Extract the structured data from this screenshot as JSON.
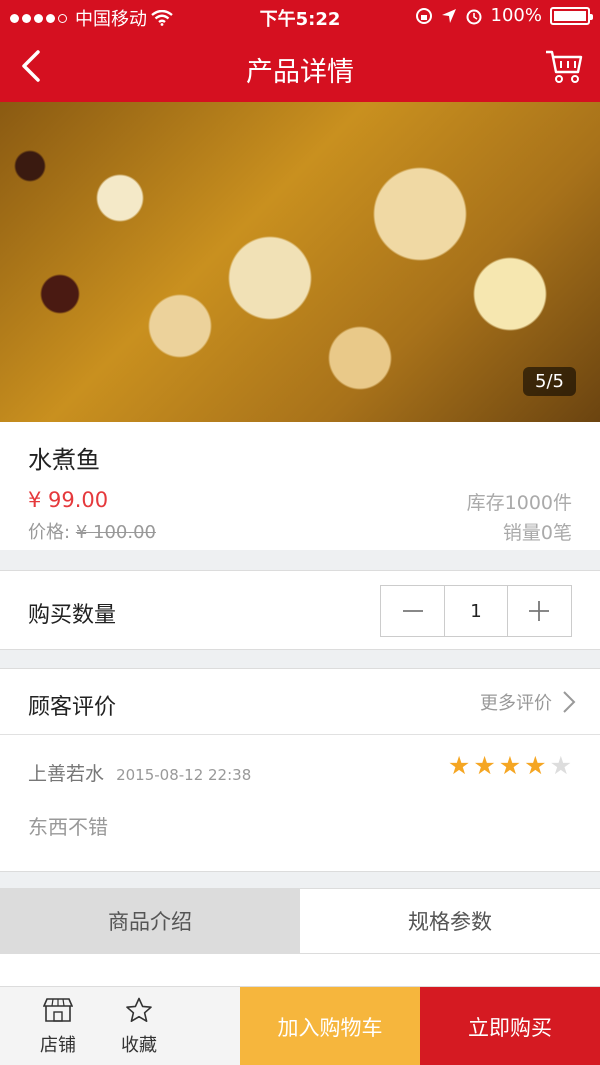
{
  "status_bar": {
    "carrier": "中国移动",
    "time": "下午5:22",
    "battery": "100%"
  },
  "nav": {
    "title": "产品详情"
  },
  "gallery": {
    "pager": "5/5"
  },
  "product": {
    "name": "水煮鱼",
    "price": "¥ 99.00",
    "original_price_label": "价格:",
    "original_price": "¥ 100.00",
    "stock": "库存1000件",
    "sales": "销量0笔"
  },
  "quantity": {
    "label": "购买数量",
    "value": "1"
  },
  "reviews": {
    "title": "顾客评价",
    "more_label": "更多评价",
    "items": [
      {
        "user": "上善若水",
        "date": "2015-08-12 22:38",
        "rating": 4,
        "max_rating": 5,
        "text": "东西不错"
      }
    ]
  },
  "tabs": [
    {
      "label": "商品介绍",
      "active": true
    },
    {
      "label": "规格参数",
      "active": false
    }
  ],
  "bottom_bar": {
    "shop_label": "店铺",
    "favorite_label": "收藏",
    "add_to_cart_label": "加入购物车",
    "buy_now_label": "立即购买"
  },
  "colors": {
    "brand_red": "#d51020",
    "price_red": "#e5393c",
    "star_active": "#f5a623",
    "star_inactive": "#dddddd",
    "add_cart_orange": "#f6b63d"
  }
}
